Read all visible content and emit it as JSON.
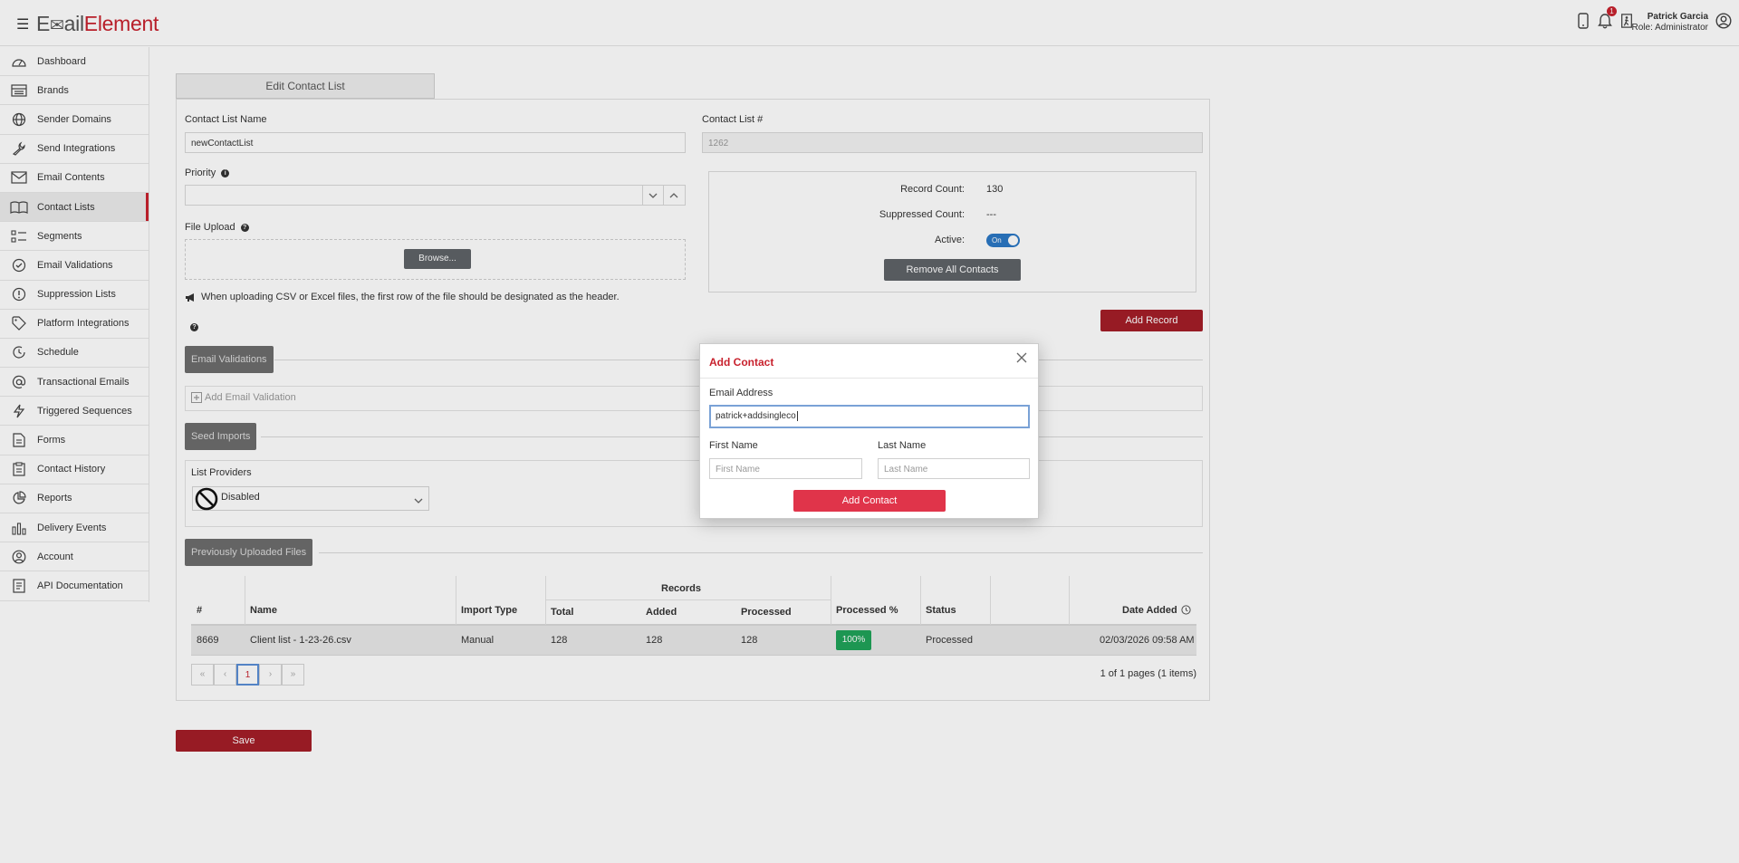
{
  "header": {
    "logo_part1": "E",
    "logo_part2": "ail",
    "logo_part3": "Element",
    "notification_count": "1",
    "user_name": "Patrick Garcia",
    "user_role": "Role: Administrator"
  },
  "sidebar": {
    "items": [
      {
        "label": "Dashboard",
        "icon": "gauge-icon"
      },
      {
        "label": "Brands",
        "icon": "storefront-icon"
      },
      {
        "label": "Sender Domains",
        "icon": "globe-icon"
      },
      {
        "label": "Send Integrations",
        "icon": "wrench-icon"
      },
      {
        "label": "Email Contents",
        "icon": "envelope-icon"
      },
      {
        "label": "Contact Lists",
        "icon": "book-icon"
      },
      {
        "label": "Segments",
        "icon": "segments-icon"
      },
      {
        "label": "Email Validations",
        "icon": "check-circle-icon"
      },
      {
        "label": "Suppression Lists",
        "icon": "exclamation-circle-icon"
      },
      {
        "label": "Platform Integrations",
        "icon": "tag-icon"
      },
      {
        "label": "Schedule",
        "icon": "clock-icon"
      },
      {
        "label": "Transactional Emails",
        "icon": "at-icon"
      },
      {
        "label": "Triggered Sequences",
        "icon": "lightning-icon"
      },
      {
        "label": "Forms",
        "icon": "form-icon"
      },
      {
        "label": "Contact History",
        "icon": "clipboard-icon"
      },
      {
        "label": "Reports",
        "icon": "pie-chart-icon"
      },
      {
        "label": "Delivery Events",
        "icon": "bar-chart-icon"
      },
      {
        "label": "Account",
        "icon": "user-circle-icon"
      },
      {
        "label": "API Documentation",
        "icon": "document-icon"
      }
    ]
  },
  "form": {
    "tab_label": "Edit Contact List",
    "name_label": "Contact List Name",
    "name_value": "newContactList",
    "number_label": "Contact List #",
    "number_value": "1262",
    "priority_label": "Priority",
    "file_upload_label": "File Upload",
    "browse_label": "Browse...",
    "upload_hint": "When uploading CSV or Excel files, the first row of the file should be designated as the header.",
    "record_count_label": "Record Count:",
    "record_count_value": "130",
    "suppressed_label": "Suppressed Count:",
    "suppressed_value": "---",
    "active_label": "Active:",
    "active_toggle": "On",
    "remove_all_label": "Remove All Contacts",
    "add_record_label": "Add Record",
    "email_validations_label": "Email Validations",
    "add_email_validation_label": "Add Email Validation",
    "seed_imports_label": "Seed Imports",
    "list_providers_label": "List Providers",
    "list_providers_value": "Disabled",
    "previous_files_label": "Previously Uploaded Files",
    "save_label": "Save"
  },
  "table": {
    "records_group": "Records",
    "headers": [
      "#",
      "Name",
      "Import Type",
      "Total",
      "Added",
      "Processed",
      "Processed %",
      "Status",
      "Date Added"
    ],
    "rows": [
      {
        "id": "8669",
        "name": "Client list - 1-23-26.csv",
        "import_type": "Manual",
        "total": "128",
        "added": "128",
        "processed": "128",
        "processed_pct": "100%",
        "status": "Processed",
        "date_added": "02/03/2026 09:58 AM"
      }
    ],
    "pager": {
      "first": "«",
      "prev": "‹",
      "current": "1",
      "next": "›",
      "last": "»",
      "summary": "1 of 1 pages (1 items)"
    }
  },
  "modal": {
    "title": "Add Contact",
    "email_label": "Email Address",
    "email_value": "patrick+addsingleco",
    "first_name_label": "First Name",
    "first_name_placeholder": "First Name",
    "last_name_label": "Last Name",
    "last_name_placeholder": "Last Name",
    "submit_label": "Add Contact"
  },
  "colors": {
    "brand_red": "#c8222e",
    "button_red": "#a41e28",
    "modal_button": "#e0344a",
    "success_green": "#20a35a",
    "toggle_blue": "#2b78c5"
  }
}
